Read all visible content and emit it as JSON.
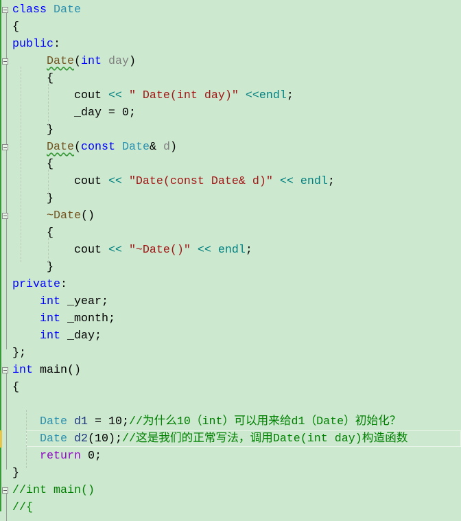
{
  "editor": {
    "colors": {
      "background": "#cce8cf",
      "keyword": "#0000ff",
      "type": "#2b91af",
      "function": "#74531f",
      "string": "#a31515",
      "comment": "#008000"
    },
    "highlighted_line": 26,
    "folded_lines": [
      1,
      4,
      9,
      13,
      22,
      29
    ],
    "lines": [
      [
        [
          "kw",
          "class"
        ],
        [
          "plain",
          " "
        ],
        [
          "type",
          "Date"
        ]
      ],
      [
        [
          "plain",
          "{"
        ]
      ],
      [
        [
          "kw",
          "public"
        ],
        [
          "plain",
          ":"
        ]
      ],
      [
        [
          "plain",
          "     "
        ],
        [
          "fn",
          "Date",
          "squig"
        ],
        [
          "plain",
          "("
        ],
        [
          "kw",
          "int"
        ],
        [
          "plain",
          " "
        ],
        [
          "param",
          "day"
        ],
        [
          "plain",
          ")"
        ]
      ],
      [
        [
          "plain",
          "     {"
        ]
      ],
      [
        [
          "plain",
          "         cout "
        ],
        [
          "op",
          "<<"
        ],
        [
          "plain",
          " "
        ],
        [
          "str",
          "\" Date(int day)\""
        ],
        [
          "plain",
          " "
        ],
        [
          "op",
          "<<"
        ],
        [
          "endl",
          "endl"
        ],
        [
          "plain",
          ";"
        ]
      ],
      [
        [
          "plain",
          "         _day = 0;"
        ]
      ],
      [
        [
          "plain",
          "     }"
        ]
      ],
      [
        [
          "plain",
          "     "
        ],
        [
          "fn",
          "Date",
          "squig"
        ],
        [
          "plain",
          "("
        ],
        [
          "kw",
          "const"
        ],
        [
          "plain",
          " "
        ],
        [
          "type",
          "Date"
        ],
        [
          "plain",
          "& "
        ],
        [
          "param",
          "d"
        ],
        [
          "plain",
          ")"
        ]
      ],
      [
        [
          "plain",
          "     {"
        ]
      ],
      [
        [
          "plain",
          "         cout "
        ],
        [
          "op",
          "<<"
        ],
        [
          "plain",
          " "
        ],
        [
          "str",
          "\"Date(const Date& d)\""
        ],
        [
          "plain",
          " "
        ],
        [
          "op",
          "<<"
        ],
        [
          "plain",
          " "
        ],
        [
          "endl",
          "endl"
        ],
        [
          "plain",
          ";"
        ]
      ],
      [
        [
          "plain",
          "     }"
        ]
      ],
      [
        [
          "plain",
          "     "
        ],
        [
          "fn",
          "~Date"
        ],
        [
          "plain",
          "()"
        ]
      ],
      [
        [
          "plain",
          "     {"
        ]
      ],
      [
        [
          "plain",
          "         cout "
        ],
        [
          "op",
          "<<"
        ],
        [
          "plain",
          " "
        ],
        [
          "str",
          "\"~Date()\""
        ],
        [
          "plain",
          " "
        ],
        [
          "op",
          "<<"
        ],
        [
          "plain",
          " "
        ],
        [
          "endl",
          "endl"
        ],
        [
          "plain",
          ";"
        ]
      ],
      [
        [
          "plain",
          "     }"
        ]
      ],
      [
        [
          "kw",
          "private"
        ],
        [
          "plain",
          ":"
        ]
      ],
      [
        [
          "plain",
          "    "
        ],
        [
          "kw",
          "int"
        ],
        [
          "plain",
          " _year;"
        ]
      ],
      [
        [
          "plain",
          "    "
        ],
        [
          "kw",
          "int"
        ],
        [
          "plain",
          " _month;"
        ]
      ],
      [
        [
          "plain",
          "    "
        ],
        [
          "kw",
          "int"
        ],
        [
          "plain",
          " _day;"
        ]
      ],
      [
        [
          "plain",
          "};"
        ]
      ],
      [
        [
          "kw",
          "int"
        ],
        [
          "plain",
          " main()"
        ]
      ],
      [
        [
          "plain",
          "{"
        ]
      ],
      [],
      [
        [
          "plain",
          "    "
        ],
        [
          "type",
          "Date"
        ],
        [
          "plain",
          " "
        ],
        [
          "var",
          "d1"
        ],
        [
          "plain",
          " = 10;"
        ],
        [
          "cmt",
          "//为什么10（int）可以用来给d1（Date）初始化？"
        ]
      ],
      [
        [
          "plain",
          "    "
        ],
        [
          "type",
          "Date"
        ],
        [
          "plain",
          " "
        ],
        [
          "var",
          "d2"
        ],
        [
          "plain",
          "(10);"
        ],
        [
          "cmt",
          "//这是我们的正常写法，调用Date(int day)构造函数"
        ]
      ],
      [
        [
          "plain",
          "    "
        ],
        [
          "ret",
          "return"
        ],
        [
          "plain",
          " 0;"
        ]
      ],
      [
        [
          "plain",
          "}"
        ]
      ],
      [
        [
          "cmt",
          "//int main()"
        ]
      ],
      [
        [
          "cmt",
          "//{"
        ]
      ]
    ]
  }
}
